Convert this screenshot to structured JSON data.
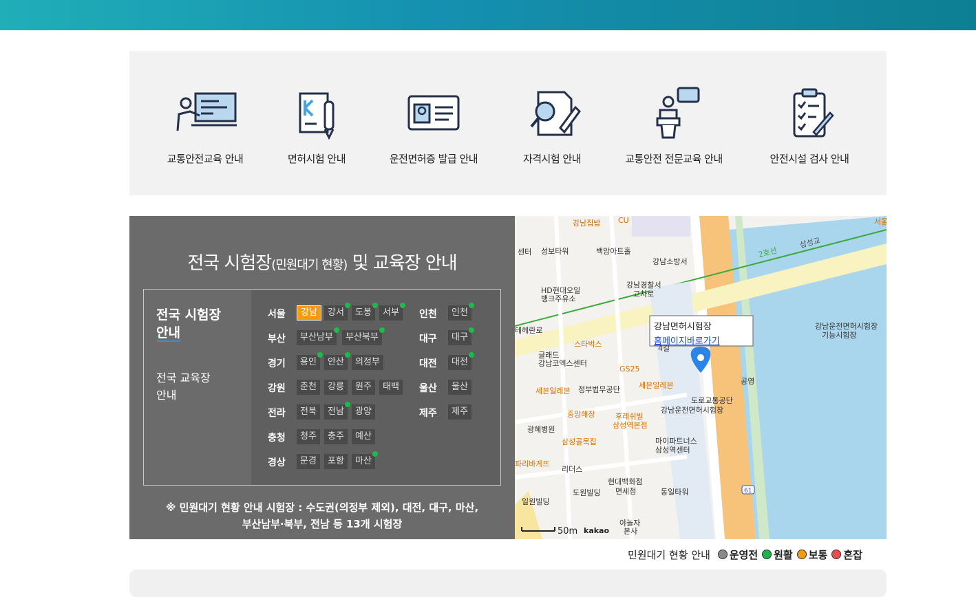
{
  "services": [
    {
      "label": "교통안전교육 안내",
      "icon": "teacher-board-icon"
    },
    {
      "label": "면허시험 안내",
      "icon": "test-paper-pen-icon"
    },
    {
      "label": "운전면허증 발급 안내",
      "icon": "id-card-icon"
    },
    {
      "label": "자격시험 안내",
      "icon": "document-search-icon"
    },
    {
      "label": "교통안전 전문교육 안내",
      "icon": "speaker-podium-icon"
    },
    {
      "label": "안전시설 검사 안내",
      "icon": "checklist-clipboard-icon"
    }
  ],
  "panel": {
    "title_main": "전국 시험장",
    "title_small": "(민원대기 현황)",
    "title_end": " 및 교육장 안내",
    "tab_exam_line1": "전국 시험장",
    "tab_exam_line2": "안내",
    "tab_edu_line1": "전국 교육장",
    "tab_edu_line2": "안내",
    "note_line1": "※ 민원대기 현황 안내 시험장 : 수도권(의정부 제외), 대전, 대구, 마산,",
    "note_line2": "부산남부·북부, 전남 등 13개 시험장",
    "left_regions": [
      {
        "name": "서울",
        "centers": [
          {
            "name": "강남",
            "selected": true,
            "dot": false
          },
          {
            "name": "강서",
            "dot": true
          },
          {
            "name": "도봉",
            "dot": true
          },
          {
            "name": "서부",
            "dot": true
          }
        ]
      },
      {
        "name": "부산",
        "centers": [
          {
            "name": "부산남부",
            "dot": true
          },
          {
            "name": "부산북부",
            "dot": true
          }
        ]
      },
      {
        "name": "경기",
        "centers": [
          {
            "name": "용인",
            "dot": true
          },
          {
            "name": "안산",
            "dot": true
          },
          {
            "name": "의정부",
            "dot": false
          }
        ]
      },
      {
        "name": "강원",
        "centers": [
          {
            "name": "춘천",
            "dot": false
          },
          {
            "name": "강릉",
            "dot": false
          },
          {
            "name": "원주",
            "dot": false
          },
          {
            "name": "태백",
            "dot": false
          }
        ]
      },
      {
        "name": "전라",
        "centers": [
          {
            "name": "전북",
            "dot": false
          },
          {
            "name": "전남",
            "dot": true
          },
          {
            "name": "광양",
            "dot": false
          }
        ]
      },
      {
        "name": "충청",
        "centers": [
          {
            "name": "청주",
            "dot": false
          },
          {
            "name": "충주",
            "dot": false
          },
          {
            "name": "예산",
            "dot": false
          }
        ]
      },
      {
        "name": "경상",
        "centers": [
          {
            "name": "문경",
            "dot": false
          },
          {
            "name": "포항",
            "dot": false
          },
          {
            "name": "마산",
            "dot": true
          }
        ]
      }
    ],
    "right_regions": [
      {
        "name": "인천",
        "centers": [
          {
            "name": "인천",
            "dot": true
          }
        ]
      },
      {
        "name": "대구",
        "centers": [
          {
            "name": "대구",
            "dot": true
          }
        ]
      },
      {
        "name": "대전",
        "centers": [
          {
            "name": "대전",
            "dot": true
          }
        ]
      },
      {
        "name": "울산",
        "centers": [
          {
            "name": "울산",
            "dot": false
          }
        ]
      },
      {
        "name": "제주",
        "centers": [
          {
            "name": "제주",
            "dot": false
          }
        ]
      }
    ]
  },
  "map": {
    "infowindow_title": "강남면허시험장",
    "infowindow_link": "홈페이지바로가기",
    "scale_label": "50m",
    "provider": "kakao",
    "subway_line": "2호선",
    "bridge": "삼성교",
    "road_number": "61",
    "labels": [
      {
        "t": "강남집밥",
        "c": "o"
      },
      {
        "t": "CU",
        "c": "o"
      },
      {
        "t": "성보타워",
        "c": ""
      },
      {
        "t": "백암아트홀",
        "c": "p"
      },
      {
        "t": "강남소방서",
        "c": ""
      },
      {
        "t": "HD현대오일",
        "c": ""
      },
      {
        "t": "뱅크주유소",
        "c": ""
      },
      {
        "t": "강남경찰서",
        "c": ""
      },
      {
        "t": "교차로",
        "c": ""
      },
      {
        "t": "스타벅스",
        "c": "o"
      },
      {
        "t": "글래드",
        "c": "p"
      },
      {
        "t": "강남코엑스센터",
        "c": "p"
      },
      {
        "t": "GS25",
        "c": "o"
      },
      {
        "t": "세븐일레븐",
        "c": "o"
      },
      {
        "t": "정부법무공단",
        "c": ""
      },
      {
        "t": "세븐일레븐",
        "c": "o"
      },
      {
        "t": "도로교통공단",
        "c": ""
      },
      {
        "t": "강남운전면허시험장",
        "c": ""
      },
      {
        "t": "중앙해장",
        "c": "o"
      },
      {
        "t": "후레쉬빌",
        "c": "o"
      },
      {
        "t": "삼성역본점",
        "c": "o"
      },
      {
        "t": "광혜병원",
        "c": ""
      },
      {
        "t": "삼성골목집",
        "c": "o"
      },
      {
        "t": "마이파트너스",
        "c": ""
      },
      {
        "t": "삼성역센터",
        "c": ""
      },
      {
        "t": "리더스",
        "c": ""
      },
      {
        "t": "현대백화점",
        "c": ""
      },
      {
        "t": "면세점",
        "c": ""
      },
      {
        "t": "도원빌딩",
        "c": ""
      },
      {
        "t": "동일타워",
        "c": ""
      },
      {
        "t": "일원빌딩",
        "c": ""
      },
      {
        "t": "야놀자",
        "c": ""
      },
      {
        "t": "본사",
        "c": ""
      },
      {
        "t": "공영",
        "c": ""
      },
      {
        "t": "강남운전면허시험장",
        "c": ""
      },
      {
        "t": "기능시험장",
        "c": ""
      },
      {
        "t": "서울",
        "c": "o"
      },
      {
        "t": "파리바게뜨",
        "c": "o"
      },
      {
        "t": "센터",
        "c": ""
      },
      {
        "t": "테헤란로",
        "c": ""
      },
      {
        "t": "4길",
        "c": ""
      }
    ]
  },
  "legend": {
    "label": "민원대기 현황 안내",
    "items": [
      {
        "label": "운영전",
        "color": "#8a8a8a"
      },
      {
        "label": "원활",
        "color": "#1db24a"
      },
      {
        "label": "보통",
        "color": "#f39c12"
      },
      {
        "label": "혼잡",
        "color": "#e94d4d"
      }
    ]
  }
}
